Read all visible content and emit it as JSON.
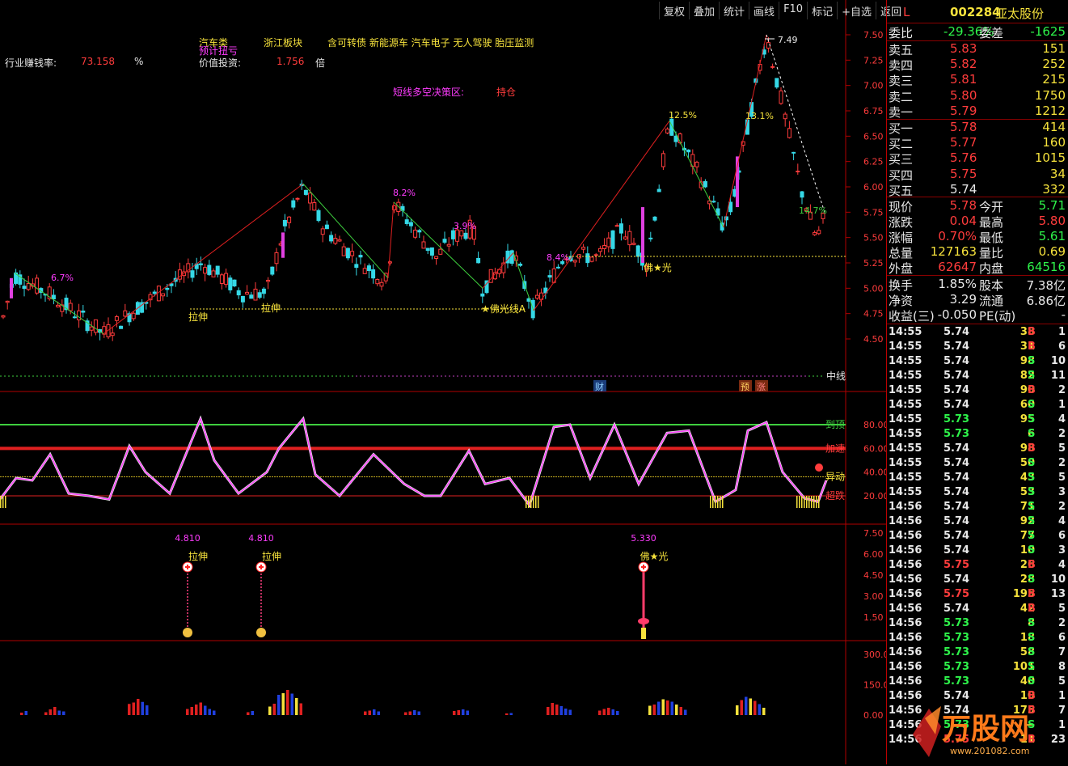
{
  "toolbar": [
    "复权",
    "叠加",
    "统计",
    "画线",
    "F10",
    "标记",
    "+自选",
    "返回"
  ],
  "header": {
    "sector1": "汽车类",
    "sector1_sub": "预计扭亏",
    "sector2": "浙江板块",
    "concepts": "含可转债 新能源车 汽车电子 无人驾驶 胎压监测",
    "industry_label": "行业赚钱率:",
    "industry_value": "73.158",
    "industry_unit": "%",
    "value_label": "价值投资:",
    "value_value": "1.756",
    "value_unit": "倍",
    "decision_label": "短线多空决策区:",
    "decision_value": "持仓"
  },
  "main_chart": {
    "price_axis": [
      "7.50",
      "7.25",
      "7.00",
      "6.75",
      "6.50",
      "6.25",
      "6.00",
      "5.75",
      "5.50",
      "5.25",
      "5.00",
      "4.75",
      "4.50"
    ],
    "high_label": "7.49",
    "pct_labels": [
      "6.7%",
      "8.2%",
      "3.9%",
      "12.5%",
      "13.1%",
      "8.4%",
      "14.7%"
    ],
    "markers": [
      "拉伸",
      "拉伸",
      "★佛光线A",
      "佛★光"
    ],
    "mid_label": "中线",
    "badges": [
      "财",
      "预",
      "涨"
    ]
  },
  "osc": {
    "labels": [
      "到顶",
      "加速",
      "异动",
      "超跌"
    ],
    "axis": [
      "80.00",
      "60.00",
      "40.00",
      "20.00"
    ]
  },
  "signals": {
    "axis": [
      "7.50",
      "6.00",
      "4.50",
      "3.00",
      "1.50"
    ],
    "items": [
      {
        "value": "4.810",
        "label": "拉伸"
      },
      {
        "value": "4.810",
        "label": "拉伸"
      },
      {
        "value": "5.330",
        "label": "佛★光"
      }
    ]
  },
  "volume": {
    "axis": [
      "300.0",
      "150.0",
      "0.00"
    ]
  },
  "stock": {
    "mark": "L",
    "code": "002284",
    "name": "亚太股份"
  },
  "quote": {
    "wb_label": "委比",
    "wb_value": "-29.36%",
    "wc_label": "委差",
    "wc_value": "-1625",
    "asks": [
      {
        "label": "卖五",
        "price": "5.83",
        "vol": "151"
      },
      {
        "label": "卖四",
        "price": "5.82",
        "vol": "252"
      },
      {
        "label": "卖三",
        "price": "5.81",
        "vol": "215"
      },
      {
        "label": "卖二",
        "price": "5.80",
        "vol": "1750"
      },
      {
        "label": "卖一",
        "price": "5.79",
        "vol": "1212"
      }
    ],
    "bids": [
      {
        "label": "买一",
        "price": "5.78",
        "vol": "414"
      },
      {
        "label": "买二",
        "price": "5.77",
        "vol": "160"
      },
      {
        "label": "买三",
        "price": "5.76",
        "vol": "1015"
      },
      {
        "label": "买四",
        "price": "5.75",
        "vol": "34"
      },
      {
        "label": "买五",
        "price": "5.74",
        "vol": "332"
      }
    ],
    "stats": [
      {
        "l1": "现价",
        "v1": "5.78",
        "l2": "今开",
        "v2": "5.71"
      },
      {
        "l1": "涨跌",
        "v1": "0.04",
        "l2": "最高",
        "v2": "5.80"
      },
      {
        "l1": "涨幅",
        "v1": "0.70%",
        "l2": "最低",
        "v2": "5.61"
      },
      {
        "l1": "总量",
        "v1": "127163",
        "l2": "量比",
        "v2": "0.69"
      },
      {
        "l1": "外盘",
        "v1": "62647",
        "l2": "内盘",
        "v2": "64516"
      }
    ],
    "stats2": [
      {
        "l1": "换手",
        "v1": "1.85%",
        "l2": "股本",
        "v2": "7.38亿"
      },
      {
        "l1": "净资",
        "v1": "3.29",
        "l2": "流通",
        "v2": "6.86亿"
      },
      {
        "l1": "收益(三)",
        "v1": "-0.050",
        "l2": "PE(动)",
        "v2": "-"
      }
    ]
  },
  "ticks": [
    [
      "14:55",
      "5.74",
      "38",
      "B",
      "1"
    ],
    [
      "14:55",
      "5.74",
      "31",
      "B",
      "6"
    ],
    [
      "14:55",
      "5.74",
      "98",
      "S",
      "10"
    ],
    [
      "14:55",
      "5.74",
      "82",
      "S",
      "11"
    ],
    [
      "14:55",
      "5.74",
      "90",
      "B",
      "2"
    ],
    [
      "14:55",
      "5.74",
      "60",
      "S",
      "1"
    ],
    [
      "14:55",
      "5.73",
      "95",
      "S",
      "4"
    ],
    [
      "14:55",
      "5.73",
      "6",
      "S",
      "2"
    ],
    [
      "14:55",
      "5.74",
      "98",
      "B",
      "5"
    ],
    [
      "14:55",
      "5.74",
      "50",
      "S",
      "2"
    ],
    [
      "14:55",
      "5.74",
      "43",
      "S",
      "5"
    ],
    [
      "14:55",
      "5.74",
      "53",
      "S",
      "3"
    ],
    [
      "14:56",
      "5.74",
      "71",
      "S",
      "2"
    ],
    [
      "14:56",
      "5.74",
      "92",
      "S",
      "4"
    ],
    [
      "14:56",
      "5.74",
      "77",
      "S",
      "6"
    ],
    [
      "14:56",
      "5.74",
      "10",
      "S",
      "3"
    ],
    [
      "14:56",
      "5.75",
      "26",
      "B",
      "4"
    ],
    [
      "14:56",
      "5.74",
      "28",
      "S",
      "10"
    ],
    [
      "14:56",
      "5.75",
      "195",
      "B",
      "13"
    ],
    [
      "14:56",
      "5.74",
      "42",
      "B",
      "5"
    ],
    [
      "14:56",
      "5.73",
      "8",
      "S",
      "2"
    ],
    [
      "14:56",
      "5.73",
      "18",
      "S",
      "6"
    ],
    [
      "14:56",
      "5.73",
      "58",
      "S",
      "7"
    ],
    [
      "14:56",
      "5.73",
      "101",
      "S",
      "8"
    ],
    [
      "14:56",
      "5.73",
      "40",
      "S",
      "5"
    ],
    [
      "14:56",
      "5.74",
      "10",
      "B",
      "1"
    ],
    [
      "14:56",
      "5.74",
      "175",
      "B",
      "7"
    ],
    [
      "14:56",
      "5.73",
      "—",
      "S",
      "1"
    ],
    [
      "14:56",
      "5.75",
      "11",
      "B",
      "23"
    ]
  ],
  "watermark": {
    "text": "万股网",
    "url": "www.201082.com"
  },
  "colors": {
    "up": "#ff3c3c",
    "down": "#2ef34a",
    "accent": "#f6e23c",
    "frame": "#b00000",
    "magenta": "#ff3cff",
    "cyan": "#4fd7ff"
  }
}
